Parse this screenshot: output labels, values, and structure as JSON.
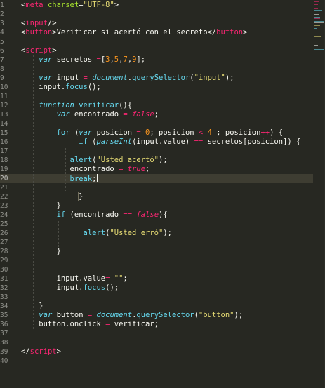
{
  "editor": {
    "lines": [
      {
        "n": "1",
        "tokens": [
          [
            "punct",
            "<"
          ],
          [
            "tag",
            "meta"
          ],
          [
            "plain",
            " "
          ],
          [
            "attr",
            "charset"
          ],
          [
            "punct",
            "="
          ],
          [
            "str",
            "\"UTF-8\""
          ],
          [
            "punct",
            ">"
          ]
        ]
      },
      {
        "n": "2",
        "tokens": []
      },
      {
        "n": "3",
        "tokens": [
          [
            "punct",
            "<"
          ],
          [
            "tag",
            "input"
          ],
          [
            "punct",
            "/>"
          ]
        ]
      },
      {
        "n": "4",
        "tokens": [
          [
            "punct",
            "<"
          ],
          [
            "tag",
            "button"
          ],
          [
            "punct",
            ">"
          ],
          [
            "plain",
            "Verificar si acertó con el secreto"
          ],
          [
            "punct",
            "</"
          ],
          [
            "tag",
            "button"
          ],
          [
            "punct",
            ">"
          ]
        ]
      },
      {
        "n": "5",
        "tokens": []
      },
      {
        "n": "6",
        "tokens": [
          [
            "punct",
            "<"
          ],
          [
            "tag",
            "script"
          ],
          [
            "punct",
            ">"
          ]
        ]
      },
      {
        "n": "7",
        "tokens": [
          [
            "plain",
            "    "
          ],
          [
            "kw",
            "var"
          ],
          [
            "plain",
            " secretos "
          ],
          [
            "op",
            "="
          ],
          [
            "plain",
            "["
          ],
          [
            "num",
            "3"
          ],
          [
            "plain",
            ","
          ],
          [
            "num",
            "5"
          ],
          [
            "plain",
            ","
          ],
          [
            "num",
            "7"
          ],
          [
            "plain",
            ","
          ],
          [
            "num",
            "9"
          ],
          [
            "plain",
            "];"
          ]
        ]
      },
      {
        "n": "8",
        "tokens": []
      },
      {
        "n": "9",
        "tokens": [
          [
            "plain",
            "    "
          ],
          [
            "kw",
            "var"
          ],
          [
            "plain",
            " input "
          ],
          [
            "op",
            "="
          ],
          [
            "plain",
            " "
          ],
          [
            "obj",
            "document"
          ],
          [
            "plain",
            "."
          ],
          [
            "fn",
            "querySelector"
          ],
          [
            "plain",
            "("
          ],
          [
            "str",
            "\"input\""
          ],
          [
            "plain",
            ");"
          ]
        ]
      },
      {
        "n": "10",
        "tokens": [
          [
            "plain",
            "    input."
          ],
          [
            "fn",
            "focus"
          ],
          [
            "plain",
            "();"
          ]
        ]
      },
      {
        "n": "11",
        "tokens": []
      },
      {
        "n": "12",
        "tokens": [
          [
            "plain",
            "    "
          ],
          [
            "kw",
            "function"
          ],
          [
            "plain",
            " "
          ],
          [
            "fn",
            "verificar"
          ],
          [
            "plain",
            "(){"
          ]
        ]
      },
      {
        "n": "13",
        "tokens": [
          [
            "plain",
            "        "
          ],
          [
            "kw",
            "var"
          ],
          [
            "plain",
            " encontrado "
          ],
          [
            "op",
            "="
          ],
          [
            "plain",
            " "
          ],
          [
            "bool",
            "false"
          ],
          [
            "plain",
            ";"
          ]
        ]
      },
      {
        "n": "14",
        "tokens": []
      },
      {
        "n": "15",
        "tokens": [
          [
            "plain",
            "        "
          ],
          [
            "op2",
            "for"
          ],
          [
            "plain",
            " ("
          ],
          [
            "kw",
            "var"
          ],
          [
            "plain",
            " posicion "
          ],
          [
            "op",
            "="
          ],
          [
            "plain",
            " "
          ],
          [
            "num",
            "0"
          ],
          [
            "plain",
            "; posicion "
          ],
          [
            "op",
            "<"
          ],
          [
            "plain",
            " "
          ],
          [
            "num",
            "4"
          ],
          [
            "plain",
            " ; posicion"
          ],
          [
            "op",
            "++"
          ],
          [
            "plain",
            ") {"
          ]
        ]
      },
      {
        "n": "16",
        "tokens": [
          [
            "plain",
            "             "
          ],
          [
            "op2",
            "if"
          ],
          [
            "plain",
            " ("
          ],
          [
            "obj",
            "parseInt"
          ],
          [
            "plain",
            "(input.value) "
          ],
          [
            "op",
            "=="
          ],
          [
            "plain",
            " secretos[posicion]) {"
          ]
        ]
      },
      {
        "n": "17",
        "tokens": []
      },
      {
        "n": "18",
        "tokens": [
          [
            "plain",
            "           "
          ],
          [
            "fn",
            "alert"
          ],
          [
            "plain",
            "("
          ],
          [
            "str",
            "\"Usted acertó\""
          ],
          [
            "plain",
            ");"
          ]
        ]
      },
      {
        "n": "19",
        "tokens": [
          [
            "plain",
            "           encontrado "
          ],
          [
            "op",
            "="
          ],
          [
            "plain",
            " "
          ],
          [
            "bool",
            "true"
          ],
          [
            "plain",
            ";"
          ]
        ]
      },
      {
        "n": "20",
        "tokens": [
          [
            "plain",
            "           "
          ],
          [
            "fn",
            "break"
          ],
          [
            "plain",
            ";"
          ]
        ],
        "active": true
      },
      {
        "n": "21",
        "tokens": []
      },
      {
        "n": "22",
        "tokens": [
          [
            "plain",
            "             "
          ],
          [
            "plainhl",
            "}"
          ]
        ]
      },
      {
        "n": "23",
        "tokens": [
          [
            "plain",
            "        }"
          ]
        ]
      },
      {
        "n": "24",
        "tokens": [
          [
            "plain",
            "        "
          ],
          [
            "op2",
            "if"
          ],
          [
            "plain",
            " (encontrado "
          ],
          [
            "op",
            "=="
          ],
          [
            "plain",
            " "
          ],
          [
            "bool",
            "false"
          ],
          [
            "plain",
            "){"
          ]
        ]
      },
      {
        "n": "25",
        "tokens": []
      },
      {
        "n": "26",
        "tokens": [
          [
            "plain",
            "              "
          ],
          [
            "fn",
            "alert"
          ],
          [
            "plain",
            "("
          ],
          [
            "str",
            "\"Usted erró\""
          ],
          [
            "plain",
            ");"
          ]
        ]
      },
      {
        "n": "27",
        "tokens": []
      },
      {
        "n": "28",
        "tokens": [
          [
            "plain",
            "        }"
          ]
        ]
      },
      {
        "n": "29",
        "tokens": []
      },
      {
        "n": "30",
        "tokens": []
      },
      {
        "n": "31",
        "tokens": [
          [
            "plain",
            "        input.value"
          ],
          [
            "op",
            "="
          ],
          [
            "plain",
            " "
          ],
          [
            "str",
            "\"\""
          ],
          [
            "plain",
            ";"
          ]
        ]
      },
      {
        "n": "32",
        "tokens": [
          [
            "plain",
            "        input."
          ],
          [
            "fn",
            "focus"
          ],
          [
            "plain",
            "();"
          ]
        ]
      },
      {
        "n": "33",
        "tokens": []
      },
      {
        "n": "34",
        "tokens": [
          [
            "plain",
            "    }"
          ]
        ]
      },
      {
        "n": "35",
        "tokens": [
          [
            "plain",
            "    "
          ],
          [
            "kw",
            "var"
          ],
          [
            "plain",
            " button "
          ],
          [
            "op",
            "="
          ],
          [
            "plain",
            " "
          ],
          [
            "obj",
            "document"
          ],
          [
            "plain",
            "."
          ],
          [
            "fn",
            "querySelector"
          ],
          [
            "plain",
            "("
          ],
          [
            "str",
            "\"button\""
          ],
          [
            "plain",
            ");"
          ]
        ]
      },
      {
        "n": "36",
        "tokens": [
          [
            "plain",
            "    button.onclick "
          ],
          [
            "op",
            "="
          ],
          [
            "plain",
            " verificar;"
          ]
        ]
      },
      {
        "n": "37",
        "tokens": []
      },
      {
        "n": "38",
        "tokens": []
      },
      {
        "n": "39",
        "tokens": [
          [
            "punct",
            "</"
          ],
          [
            "tag",
            "script"
          ],
          [
            "punct",
            ">"
          ]
        ]
      },
      {
        "n": "40",
        "tokens": []
      }
    ]
  },
  "theme": {
    "background": "#272822",
    "plain": "#f8f8f2",
    "punct": "#f8f8f2",
    "tag": "#f92672",
    "attr": "#a6e22e",
    "str": "#e6db74",
    "kw": "#66d9ef",
    "op": "#f92672",
    "op2": "#66d9ef",
    "num": "#fd971f",
    "fn": "#66d9ef",
    "obj": "#66d9ef",
    "bool": "#f92672",
    "plainhl": "#f8f8f2"
  }
}
